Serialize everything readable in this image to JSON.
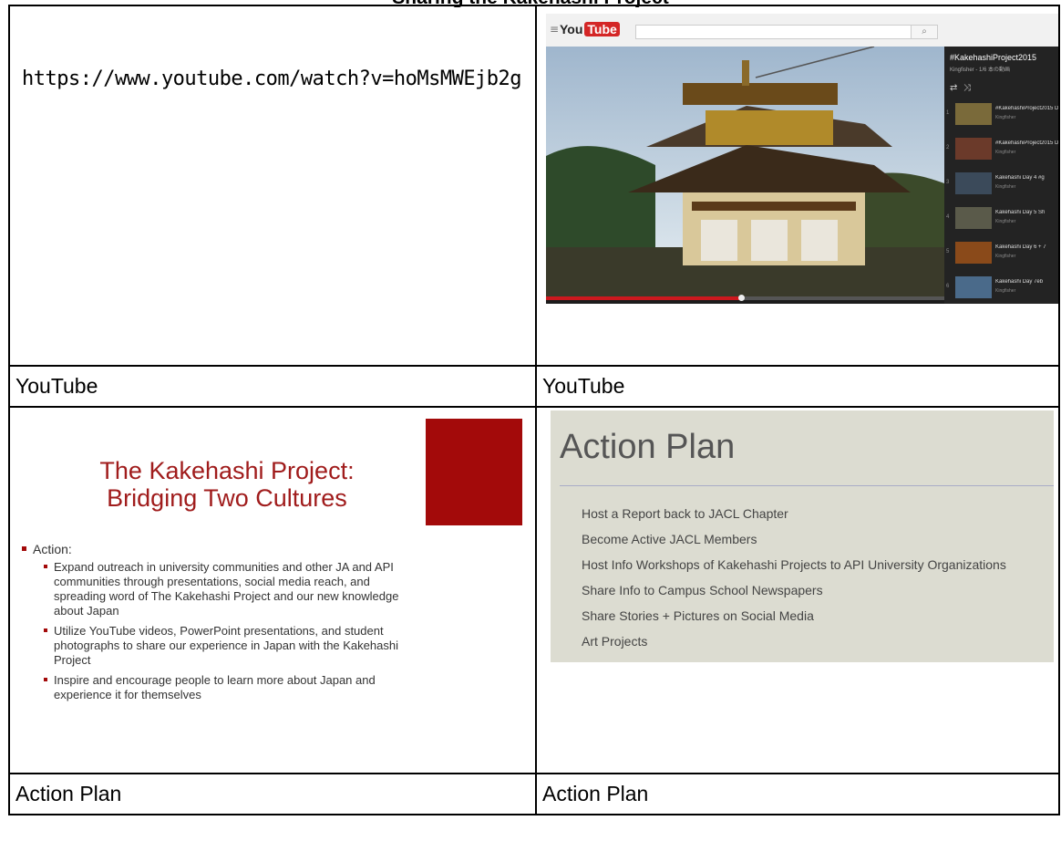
{
  "document": {
    "title": "Sharing the Kakehashi Project"
  },
  "row1": {
    "left": {
      "url": "https://www.youtube.com/watch?v=hoMsMWEjb2g"
    },
    "right": {
      "youtube": {
        "logo_you": "You",
        "logo_tube": "Tube",
        "search_icon": "search-icon",
        "playlist_title": "#KakehashiProject2015",
        "playlist_sub": "Kingfisher - 1/6 本の動画",
        "items": [
          {
            "num": "1",
            "title": "#KakehashiProject2015 Day",
            "sub": "Kingfisher",
            "color": "#7a6a3a"
          },
          {
            "num": "2",
            "title": "#KakehashiProject2015 Day",
            "sub": "Kingfisher",
            "color": "#6b3a2a"
          },
          {
            "num": "3",
            "title": "Kakehashi Day 4 #g",
            "sub": "Kingfisher",
            "color": "#3b4a5a"
          },
          {
            "num": "4",
            "title": "Kakehashi Day 5 Sh",
            "sub": "Kingfisher",
            "color": "#5a5a4a"
          },
          {
            "num": "5",
            "title": "Kakehashi Day 6 + 7",
            "sub": "Kingfisher",
            "color": "#8a4a1a"
          },
          {
            "num": "6",
            "title": "Kakehashi Day 7eb",
            "sub": "Kingfisher",
            "color": "#4a6a8a"
          }
        ],
        "progress": 0.49
      }
    }
  },
  "captions1": {
    "left": "YouTube",
    "right": "YouTube"
  },
  "row2": {
    "left": {
      "title": "The Kakehashi Project: Bridging Two Cultures",
      "action_label": "Action:",
      "bullets": [
        "Expand outreach in university communities and other JA and API communities through presentations, social media reach, and spreading word of The Kakehashi Project and our new knowledge about Japan",
        "Utilize YouTube videos, PowerPoint presentations, and student photographs to share our experience in Japan with the Kakehashi Project",
        "Inspire and encourage people to learn more about Japan and experience it for themselves"
      ]
    },
    "right": {
      "title": "Action Plan",
      "items": [
        "Host a Report back to JACL Chapter",
        "Become Active JACL Members",
        "Host Info Workshops of Kakehashi Projects to API University Organizations",
        "Share Info to Campus School Newspapers",
        "Share Stories + Pictures on Social Media",
        "Art Projects"
      ]
    }
  },
  "captions2": {
    "left": "Action Plan",
    "right": "Action Plan"
  }
}
